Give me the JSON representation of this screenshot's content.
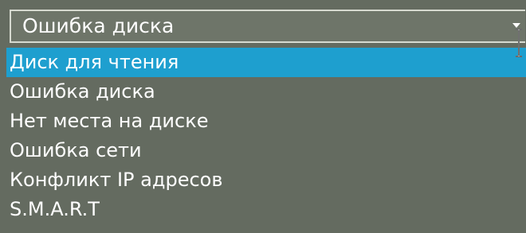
{
  "dropdown": {
    "selected_value": "Ошибка диска",
    "options": [
      {
        "label": "Диск для чтения",
        "highlighted": true
      },
      {
        "label": "Ошибка диска",
        "highlighted": false
      },
      {
        "label": "Нет места на диске",
        "highlighted": false
      },
      {
        "label": "Ошибка сети",
        "highlighted": false
      },
      {
        "label": "Конфликт IP адресов",
        "highlighted": false
      },
      {
        "label": "S.M.A.R.T",
        "highlighted": false
      }
    ]
  },
  "colors": {
    "background": "#646b60",
    "highlight": "#1e9fcf",
    "text": "#ffffff"
  }
}
